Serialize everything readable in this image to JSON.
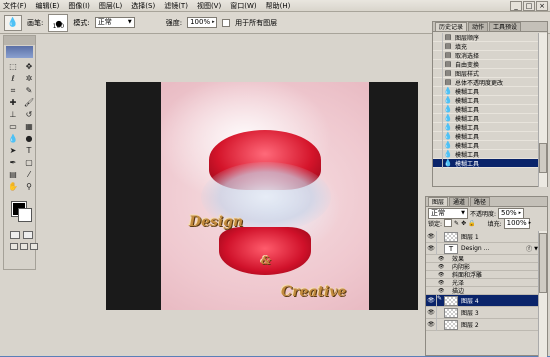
{
  "menu": {
    "items": [
      "文件(F)",
      "编辑(E)",
      "图像(I)",
      "图层(L)",
      "选择(S)",
      "滤镜(T)",
      "视图(V)",
      "窗口(W)",
      "帮助(H)"
    ]
  },
  "window_buttons": [
    "_",
    "□",
    "×"
  ],
  "options": {
    "brush_label": "画笔:",
    "brush_size": "100",
    "mode_label": "模式:",
    "mode_value": "正常",
    "strength_label": "强度:",
    "strength_value": "100%",
    "all_layers_label": "用于所有图层"
  },
  "history": {
    "tabs": [
      "历史记录",
      "动作",
      "工具预设"
    ],
    "items": [
      {
        "label": "图层顺序",
        "selected": false
      },
      {
        "label": "填充",
        "selected": false
      },
      {
        "label": "取消选择",
        "selected": false
      },
      {
        "label": "自由变换",
        "selected": false
      },
      {
        "label": "图层样式",
        "selected": false
      },
      {
        "label": "总体不透明度更改",
        "selected": false
      },
      {
        "label": "模糊工具",
        "selected": false
      },
      {
        "label": "模糊工具",
        "selected": false
      },
      {
        "label": "模糊工具",
        "selected": false
      },
      {
        "label": "模糊工具",
        "selected": false
      },
      {
        "label": "模糊工具",
        "selected": false
      },
      {
        "label": "模糊工具",
        "selected": false
      },
      {
        "label": "模糊工具",
        "selected": false
      },
      {
        "label": "模糊工具",
        "selected": false
      },
      {
        "label": "模糊工具",
        "selected": true
      }
    ]
  },
  "layers": {
    "tabs": [
      "图层",
      "通道",
      "路径"
    ],
    "blend_mode": "正常",
    "opacity_label": "不透明度:",
    "opacity_value": "50%",
    "lock_label": "锁定:",
    "fill_label": "填充:",
    "fill_value": "100%",
    "items": [
      {
        "name": "图层 1",
        "type": "raster",
        "selected": false
      },
      {
        "name": "Design ...",
        "type": "text",
        "selected": false,
        "has_effects": true
      },
      {
        "name": "效果",
        "type": "fx-header"
      },
      {
        "name": "内阴影",
        "type": "fx"
      },
      {
        "name": "斜面和浮雕",
        "type": "fx"
      },
      {
        "name": "光泽",
        "type": "fx"
      },
      {
        "name": "描边",
        "type": "fx"
      },
      {
        "name": "图层 4",
        "type": "raster",
        "selected": true
      },
      {
        "name": "图层 3",
        "type": "raster",
        "selected": false
      },
      {
        "name": "图层 2",
        "type": "raster",
        "selected": false
      }
    ]
  },
  "canvas": {
    "art_text": [
      "Design",
      "&",
      "Creative"
    ]
  }
}
